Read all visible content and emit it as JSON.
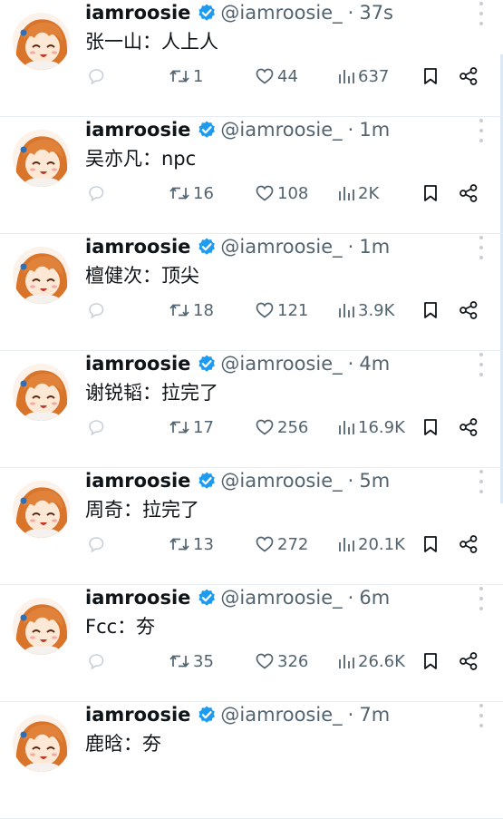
{
  "colors": {
    "verified_badge": "#1d9bf0",
    "muted_text": "#536471",
    "primary_text": "#0f1419",
    "divider": "#e6ecf0"
  },
  "tweets": [
    {
      "name": "iamroosie",
      "handle": "@iamroosie_",
      "time": "37s",
      "text": "张一山：人上人",
      "retweets": "1",
      "likes": "44",
      "views": "637"
    },
    {
      "name": "iamroosie",
      "handle": "@iamroosie_",
      "time": "1m",
      "text": "吴亦凡：npc",
      "retweets": "16",
      "likes": "108",
      "views": "2K"
    },
    {
      "name": "iamroosie",
      "handle": "@iamroosie_",
      "time": "1m",
      "text": "檀健次：顶尖",
      "retweets": "18",
      "likes": "121",
      "views": "3.9K"
    },
    {
      "name": "iamroosie",
      "handle": "@iamroosie_",
      "time": "4m",
      "text": "谢锐韬：拉完了",
      "retweets": "17",
      "likes": "256",
      "views": "16.9K"
    },
    {
      "name": "iamroosie",
      "handle": "@iamroosie_",
      "time": "5m",
      "text": "周奇：拉完了",
      "retweets": "13",
      "likes": "272",
      "views": "20.1K"
    },
    {
      "name": "iamroosie",
      "handle": "@iamroosie_",
      "time": "6m",
      "text": "Fcc：夯",
      "retweets": "35",
      "likes": "326",
      "views": "26.6K"
    },
    {
      "name": "iamroosie",
      "handle": "@iamroosie_",
      "time": "7m",
      "text": "鹿晗：夯",
      "retweets": "",
      "likes": "",
      "views": ""
    }
  ],
  "icons": {
    "reply": "reply-icon",
    "retweet": "retweet-icon",
    "like": "heart-icon",
    "views": "views-icon",
    "bookmark": "bookmark-icon",
    "share": "share-icon",
    "more": "more-icon",
    "verified": "verified-badge-icon"
  }
}
